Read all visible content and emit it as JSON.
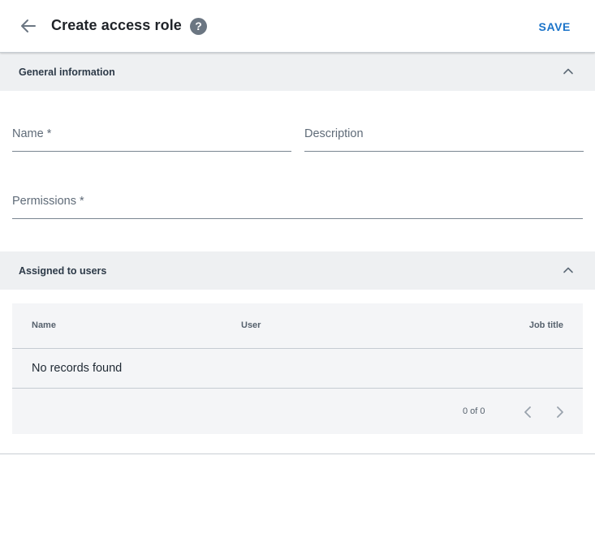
{
  "header": {
    "title": "Create access role",
    "save_label": "SAVE",
    "help_glyph": "?",
    "icons": {
      "back": "arrow-back-icon",
      "help": "help-circle-icon"
    }
  },
  "general_info": {
    "title": "General information",
    "fields": {
      "name_placeholder": "Name *",
      "description_placeholder": "Description",
      "permissions_placeholder": "Permissions *"
    }
  },
  "assigned_users": {
    "title": "Assigned to users",
    "columns": [
      "Name",
      "User",
      "Job title"
    ],
    "rows": [],
    "empty_text": "No records found",
    "pagination": {
      "range": "0 of 0"
    }
  },
  "colors": {
    "accent": "#1a73c9",
    "section_bg": "#eef0f2",
    "table_bg": "#f4f5f7"
  }
}
